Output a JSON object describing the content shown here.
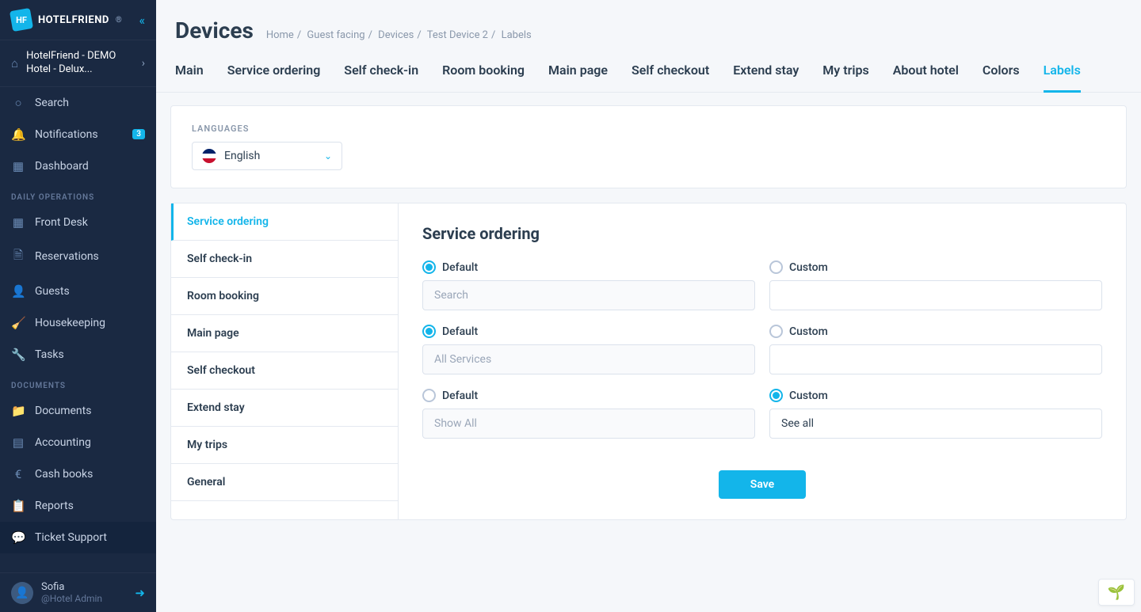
{
  "brand": {
    "name": "HOTELFRIEND",
    "logo_initials": "HF"
  },
  "hotel": {
    "name": "HotelFriend - DEMO Hotel - Delux..."
  },
  "sidebar": {
    "items": [
      {
        "label": "Search",
        "icon": "🔍"
      },
      {
        "label": "Notifications",
        "icon": "🔔",
        "badge": "3"
      },
      {
        "label": "Dashboard",
        "icon": "▦"
      }
    ],
    "section_daily": "DAILY OPERATIONS",
    "daily": [
      {
        "label": "Front Desk",
        "icon": "⊞"
      },
      {
        "label": "Reservations",
        "icon": "🗎"
      },
      {
        "label": "Guests",
        "icon": "👤"
      },
      {
        "label": "Housekeeping",
        "icon": "🧹"
      },
      {
        "label": "Tasks",
        "icon": "🔧"
      }
    ],
    "section_docs": "DOCUMENTS",
    "docs": [
      {
        "label": "Documents",
        "icon": "📁"
      },
      {
        "label": "Accounting",
        "icon": "▤"
      },
      {
        "label": "Cash books",
        "icon": "€"
      },
      {
        "label": "Reports",
        "icon": "📋"
      }
    ],
    "support": {
      "label": "Ticket Support",
      "icon": "💬"
    }
  },
  "user": {
    "name": "Sofia",
    "role": "@Hotel Admin"
  },
  "page": {
    "title": "Devices"
  },
  "breadcrumbs": [
    "Home",
    "Guest facing",
    "Devices",
    "Test Device 2",
    "Labels"
  ],
  "tabs": [
    "Main",
    "Service ordering",
    "Self check-in",
    "Room booking",
    "Main page",
    "Self checkout",
    "Extend stay",
    "My trips",
    "About hotel",
    "Colors",
    "Labels"
  ],
  "active_tab": "Labels",
  "languages": {
    "label": "LANGUAGES",
    "selected": "English"
  },
  "vtabs": [
    "Service ordering",
    "Self check-in",
    "Room booking",
    "Main page",
    "Self checkout",
    "Extend stay",
    "My trips",
    "General"
  ],
  "active_vtab": "Service ordering",
  "form": {
    "title": "Service ordering",
    "default_label": "Default",
    "custom_label": "Custom",
    "rows": [
      {
        "default_selected": true,
        "default_placeholder": "Search",
        "custom_value": ""
      },
      {
        "default_selected": true,
        "default_placeholder": "All Services",
        "custom_value": ""
      },
      {
        "default_selected": false,
        "default_placeholder": "Show All",
        "custom_value": "See all"
      }
    ],
    "save": "Save"
  }
}
